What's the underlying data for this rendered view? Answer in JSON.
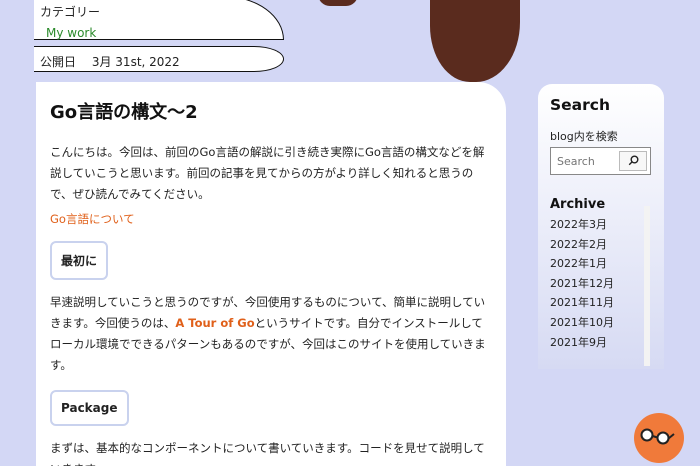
{
  "meta": {
    "category_label": "カテゴリー",
    "category_link": "My work",
    "date_label": "公開日",
    "date_value": "3月 31st, 2022"
  },
  "article": {
    "title": "Go言語の構文〜2",
    "intro": "こんにちは。今回は、前回のGo言語の解説に引き続き実際にGo言語の構文などを解説していこうと思います。前回の記事を見てからの方がより詳しく知れると思うので、ぜひ読んでみてください。",
    "intro_link": "Go言語について",
    "h1": "最初に",
    "p2_before": "早速説明していこうと思うのですが、今回使用するものについて、簡単に説明していきます。今回使うのは、",
    "p2_link": "A Tour of Go",
    "p2_after": "というサイトです。自分でインストールしてローカル環境でできるパターンもあるのですが、今回はこのサイトを使用していきます。",
    "h2": "Package",
    "p3": "まずは、基本的なコンポーネントについて書いていきます。コードを見せて説明していきます。"
  },
  "sidebar": {
    "search_title": "Search",
    "search_label": "blog内を検索",
    "search_placeholder": "Search",
    "archive_title": "Archive",
    "archive_items": [
      "2022年3月",
      "2022年2月",
      "2022年1月",
      "2021年12月",
      "2021年11月",
      "2021年10月",
      "2021年9月"
    ]
  },
  "colors": {
    "background": "#d3d7f5",
    "link": "#e0601a",
    "category_link": "#2a8a2a",
    "floating_button": "#f07a3a",
    "drip": "#5a2b1e"
  },
  "icons": {
    "search": "search-icon",
    "copy": "copy-icon",
    "floating": "glasses-icon"
  }
}
